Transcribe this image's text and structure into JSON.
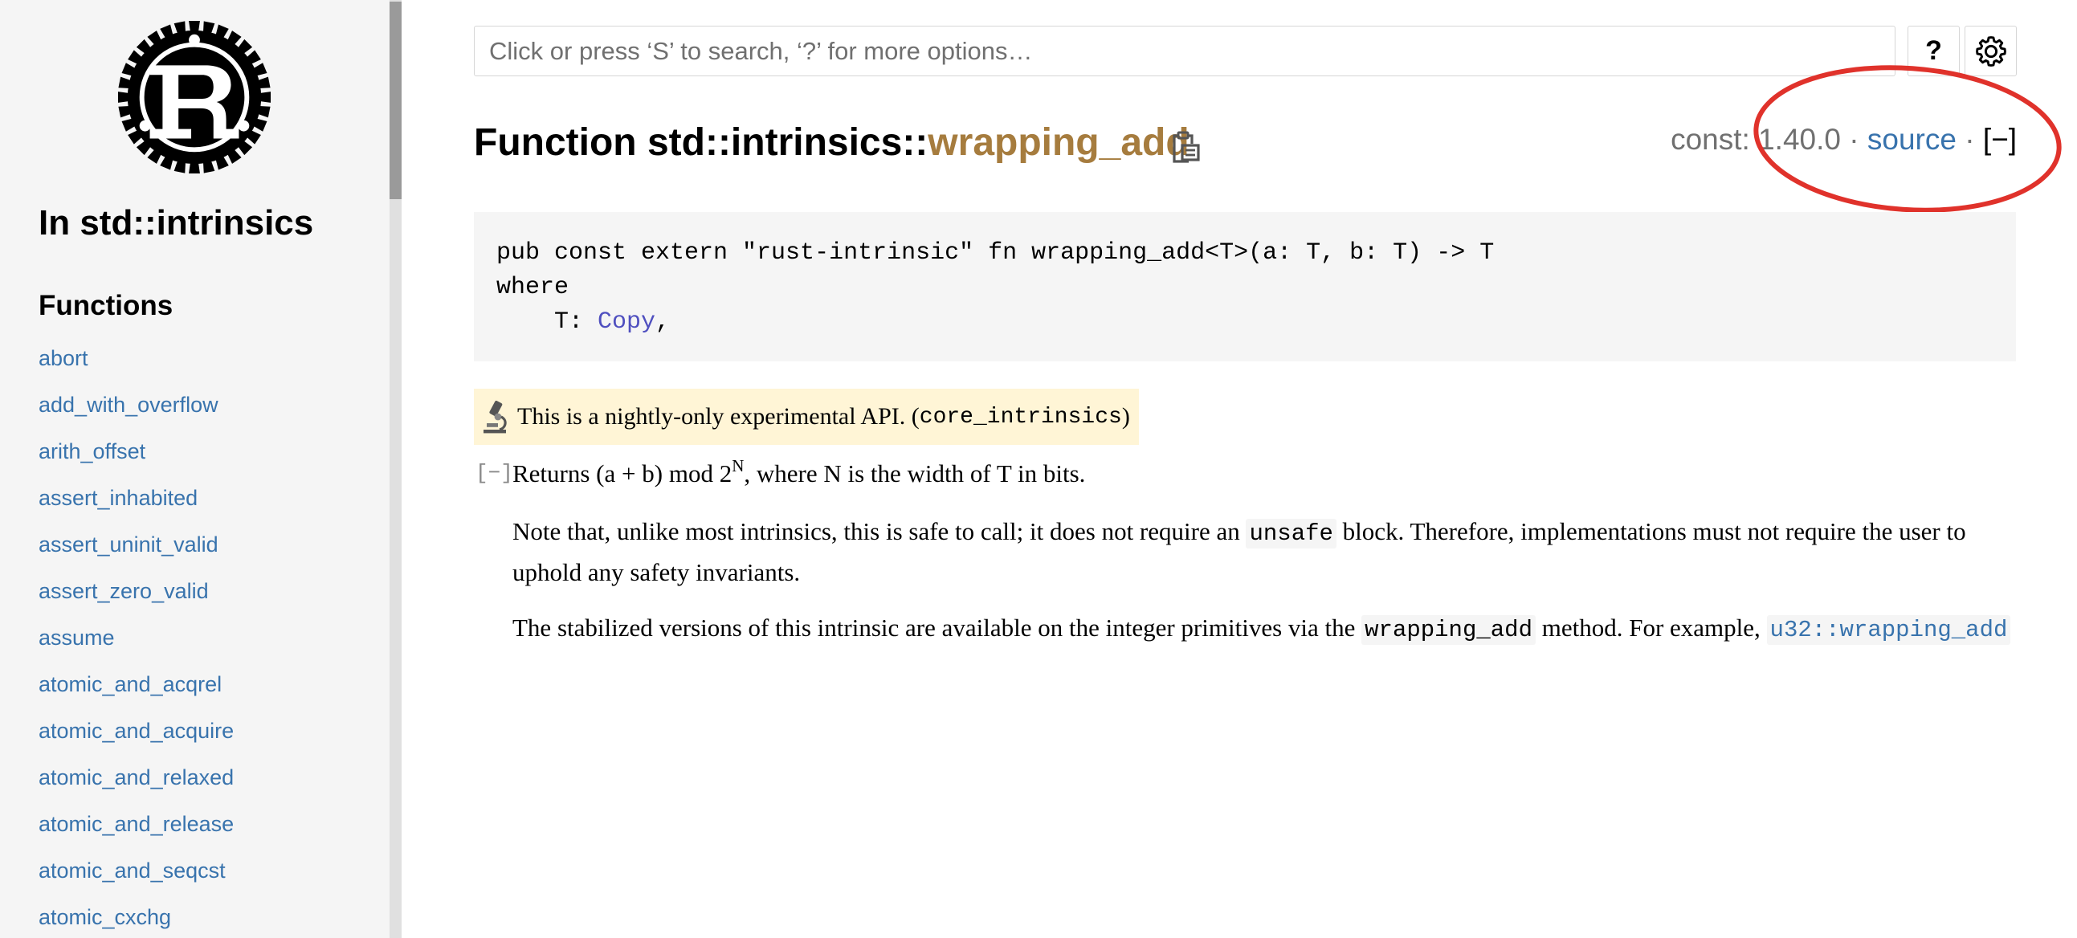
{
  "sidebar": {
    "heading": "In std::intrinsics",
    "section_title": "Functions",
    "items": [
      "abort",
      "add_with_overflow",
      "arith_offset",
      "assert_inhabited",
      "assert_uninit_valid",
      "assert_zero_valid",
      "assume",
      "atomic_and_acqrel",
      "atomic_and_acquire",
      "atomic_and_relaxed",
      "atomic_and_release",
      "atomic_and_seqcst",
      "atomic_cxchg"
    ]
  },
  "search": {
    "placeholder": "Click or press ‘S’ to search, ‘?’ for more options…",
    "help_label": "?"
  },
  "header": {
    "kind": "Function ",
    "path": "std::intrinsics::",
    "name": "wrapping_add"
  },
  "out_of_band": {
    "const_label": "const: ",
    "version": "1.40.0",
    "sep1": " · ",
    "source_label": "source",
    "sep2": " · ",
    "toggle_label": "[−]"
  },
  "code": {
    "line1": "pub const extern \"rust-intrinsic\" fn wrapping_add<T>(a: T, b: T) -> T",
    "line2": "where",
    "line3_prefix": "    T: ",
    "trait_link": "Copy",
    "line3_suffix": ","
  },
  "stability": {
    "text": "This is a nightly-only experimental API. (",
    "feature": "core_intrinsics",
    "close": ")"
  },
  "docblock": {
    "toggle": "[−]",
    "summary_before": "Returns (a + b) mod 2",
    "summary_sup": "N",
    "summary_after": ", where N is the width of T in bits.",
    "p2_before": "Note that, unlike most intrinsics, this is safe to call; it does not require an ",
    "p2_code": "unsafe",
    "p2_after": " block. Therefore, implementations must not require the user to uphold any safety invariants.",
    "p3_before": "The stabilized versions of this intrinsic are available on the integer primitives via the ",
    "p3_code": "wrapping_add",
    "p3_after": " method. For example, ",
    "p3_link": "u32::wrapping_add"
  },
  "colors": {
    "link": "#3873ad",
    "fn_name": "#a67c3e",
    "annotation": "#e0322b"
  },
  "icons": [
    "rust-logo",
    "help-icon",
    "gear-icon",
    "clipboard-icon",
    "microscope-icon"
  ]
}
